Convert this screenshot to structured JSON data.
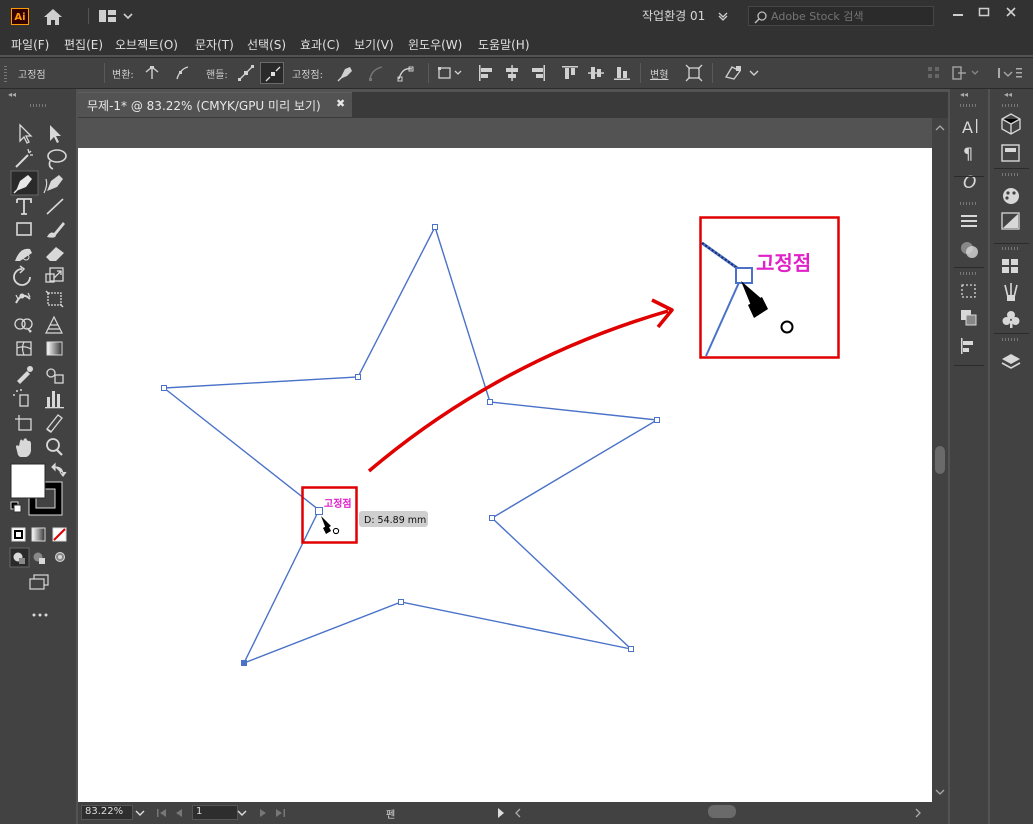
{
  "app": {
    "logo": "Ai",
    "workspace": "작업환경 01",
    "window_controls": [
      "minimize-icon",
      "maximize-icon",
      "close-icon"
    ]
  },
  "search": {
    "placeholder": "Adobe Stock 검색"
  },
  "menu": [
    "파일(F)",
    "편집(E)",
    "오브젝트(O)",
    "문자(T)",
    "선택(S)",
    "효과(C)",
    "보기(V)",
    "윈도우(W)",
    "도움말(H)"
  ],
  "control": {
    "selection_label": "고정점",
    "convert_label": "변환:",
    "handles_label": "핸들:",
    "anchor_label": "고정점:",
    "transform_label": "변형"
  },
  "document": {
    "tab_title": "무제-1* @ 83.22% (CMYK/GPU 미리 보기)",
    "close_glyph": "✖"
  },
  "status": {
    "zoom": "83.22%",
    "artboard": "1",
    "tool": "펜"
  },
  "canvas": {
    "hint_label": "고정점",
    "measure": "D: 54.89 mm",
    "zoom_label": "고정점"
  },
  "colors": {
    "path": "#4a72c8",
    "hint": "#e020c8",
    "highlight": "#e00000",
    "accent_logo": "#ff9a00"
  }
}
